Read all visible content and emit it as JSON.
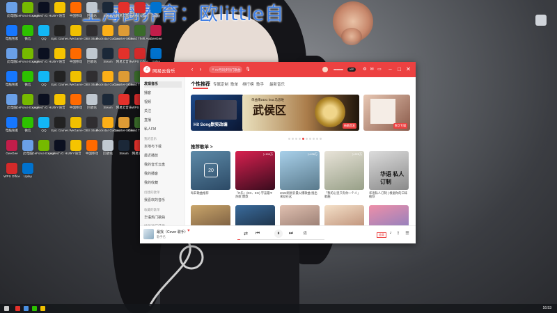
{
  "watermark": "上海倒养育：欧little自",
  "desktop_icons": [
    {
      "label": "此电脑",
      "color": "#6aa0e8"
    },
    {
      "label": "GeForce Experience",
      "color": "#76b900"
    },
    {
      "label": "Logitech G HUB",
      "color": "#0b1020"
    },
    {
      "label": "YY语音",
      "color": "#f5c400"
    },
    {
      "label": "中国移动",
      "color": "#ff6a00"
    },
    {
      "label": "回收站",
      "color": "#c0c8d0"
    },
    {
      "label": "Steam",
      "color": "#1b2838"
    },
    {
      "label": "网易云音乐",
      "color": "#e3312b"
    },
    {
      "label": "WPS Office",
      "color": "#d42a2a"
    },
    {
      "label": "Uplay",
      "color": "#0072ce"
    },
    {
      "label": "电脑管家",
      "color": "#1677ff"
    },
    {
      "label": "微信",
      "color": "#2dc100"
    },
    {
      "label": "QQ",
      "color": "#12b7f5"
    },
    {
      "label": "Epic Games",
      "color": "#222"
    },
    {
      "label": "WeGame",
      "color": "#f0c000"
    },
    {
      "label": "OBS Studio",
      "color": "#302e31"
    },
    {
      "label": "Rockstar Games",
      "color": "#fcaf17"
    },
    {
      "label": "Counter-Strike",
      "color": "#de9b35"
    },
    {
      "label": "Grand Theft Auto V",
      "color": "#3a6b2a"
    },
    {
      "label": "GeeGee",
      "color": "#c21d4a"
    }
  ],
  "app": {
    "name": "网易云音乐",
    "search_placeholder": "#7月同步热门歌曲",
    "sidebar": {
      "items": [
        "发现音乐",
        "播客",
        "视频",
        "关注",
        "直播",
        "私人FM"
      ],
      "my_music_head": "我的音乐",
      "my_items": [
        "本地与下载",
        "最近播放",
        "我的音乐云盘",
        "我的播客",
        "我的收藏"
      ],
      "created_head": "创建的歌单",
      "created_items": [
        "我喜欢的音乐"
      ],
      "collected_head": "收藏的歌单",
      "collected_items": [
        "华语热门歌曲",
        "欧美流行经典",
        "网易云热歌榜"
      ]
    },
    "tabs": [
      "个性推荐",
      "专属定制",
      "歌单",
      "排行榜",
      "歌手",
      "最新音乐"
    ],
    "banner_main": {
      "title": "武侯区",
      "subtitle": "单曲来DDG feat.马思唯",
      "tag": "新歌首发"
    },
    "banner_left": {
      "text": "Hit Song默契改编",
      "tag": "独家"
    },
    "banner_right": {
      "tag": "数字专辑"
    },
    "section_title": "推荐歌单 >",
    "playlists": [
      {
        "caption": "每日歌曲推荐",
        "count": "",
        "color1": "#5d8aa8",
        "color2": "#2c4a66"
      },
      {
        "caption": "『R乐』(DC、EG) 宇宙最Ψ热歌 爆款",
        "count": "▷190万",
        "color1": "#d8204f",
        "color2": "#3a0c1e"
      },
      {
        "caption": "2022网易云最火爆歌曲 搜出来就在这",
        "count": "▷438万",
        "color1": "#a8d0ea",
        "color2": "#5a7a8c"
      },
      {
        "caption": "「我的心里只有你一个人」 歌曲",
        "count": "▷225万",
        "color1": "#e8e3d8",
        "color2": "#98a088"
      },
      {
        "caption": "华语私人订制 | 根据你的口味推荐",
        "count": "",
        "color1": "#dcdcdc",
        "color2": "#8a8a8a"
      }
    ],
    "playlists_row2": [
      {
        "color1": "#c9a56a",
        "color2": "#5a4030"
      },
      {
        "color1": "#3a6b9c",
        "color2": "#101822"
      },
      {
        "color1": "#e0c0b0",
        "color2": "#7a6058"
      },
      {
        "color1": "#f4e0c8",
        "color2": "#a87058"
      },
      {
        "color1": "#ee8fa8",
        "color2": "#6a7ac8"
      }
    ],
    "now_playing": {
      "song": "最找（Cover 歌手）",
      "artist": "歌手名"
    },
    "banner_dots": 10,
    "banner_active": 4,
    "ui_colors": {
      "accent": "#ec4141"
    }
  },
  "taskbar": {
    "time": "16:53"
  }
}
